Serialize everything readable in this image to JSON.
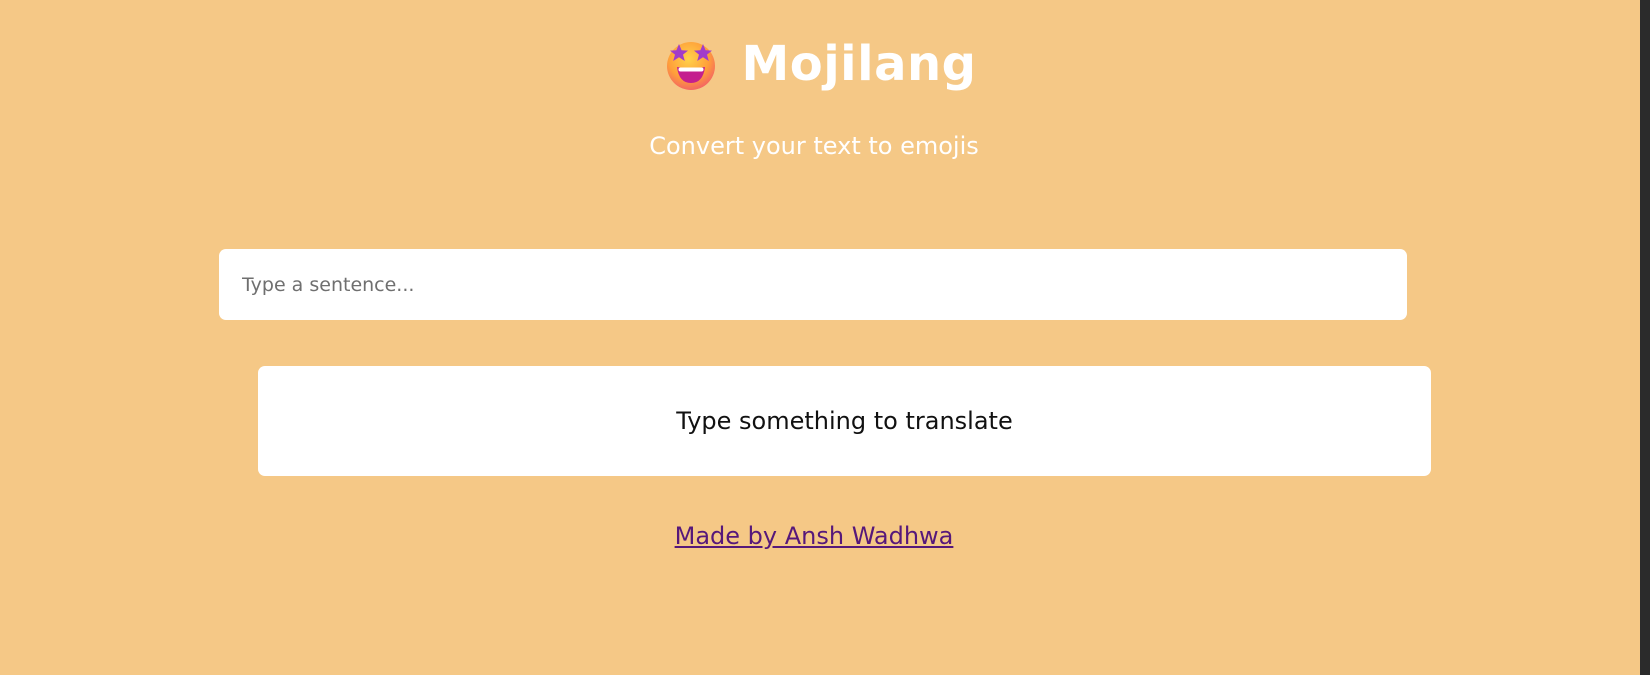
{
  "header": {
    "logo_icon": "star-struck-emoji-icon",
    "title": "Mojilang",
    "subtitle": "Convert your text to emojis"
  },
  "input": {
    "placeholder": "Type a sentence...",
    "value": ""
  },
  "output": {
    "text": "Type something to translate"
  },
  "footer": {
    "link_text": "Made by Ansh Wadhwa"
  },
  "colors": {
    "background": "#f5c886",
    "card": "#ffffff",
    "link": "#56187a"
  }
}
